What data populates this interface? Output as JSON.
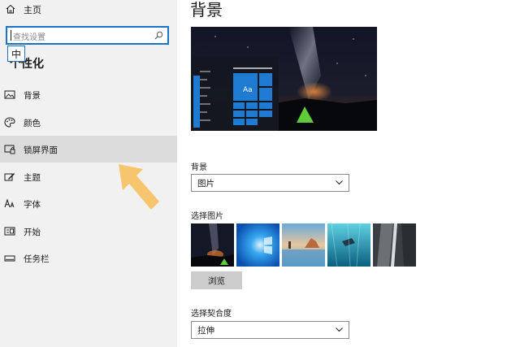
{
  "sidebar": {
    "home_label": "主页",
    "search_placeholder": "查找设置",
    "ime_indicator": "中",
    "section_title": "个性化",
    "items": [
      {
        "label": "背景",
        "icon": "image-icon",
        "selected": false
      },
      {
        "label": "颜色",
        "icon": "palette-icon",
        "selected": false
      },
      {
        "label": "锁屏界面",
        "icon": "lock-screen-icon",
        "selected": true
      },
      {
        "label": "主题",
        "icon": "theme-brush-icon",
        "selected": false
      },
      {
        "label": "字体",
        "icon": "font-icon",
        "selected": false
      },
      {
        "label": "开始",
        "icon": "start-menu-icon",
        "selected": false
      },
      {
        "label": "任务栏",
        "icon": "taskbar-icon",
        "selected": false
      }
    ]
  },
  "main": {
    "title": "背景",
    "preview_tile_text": "Aa",
    "background": {
      "label": "背景",
      "value": "图片"
    },
    "choose_picture": {
      "label": "选择图片",
      "thumbnails": [
        "galaxy-night-tent",
        "windows-blue-light",
        "beach-rocks-sunset",
        "underwater-diver",
        "rock-waterfall"
      ],
      "browse_label": "浏览"
    },
    "fit": {
      "label": "选择契合度",
      "value": "拉伸"
    }
  },
  "colors": {
    "accent": "#1a73c9",
    "sidebar_bg": "#f1f1f1",
    "selected_bg": "#dcdcdc",
    "arrow": "#f7c56e"
  }
}
